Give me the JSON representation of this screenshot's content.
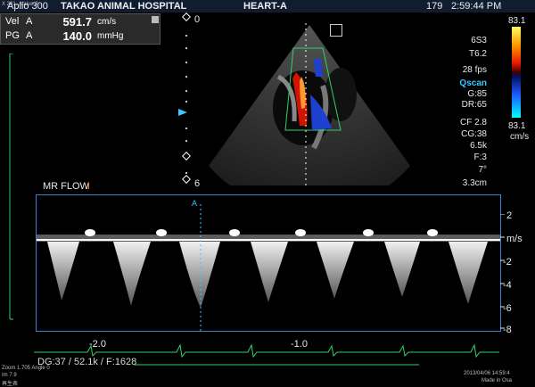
{
  "header": {
    "system": "Aplio 300",
    "hospital": "TAKAO ANIMAL HOSPITAL",
    "exam": "HEART-A",
    "frame": "179",
    "time": "2:59:44 PM",
    "corner_label": "X 201...Value 2 ..."
  },
  "measurements": [
    {
      "label": "Vel",
      "channel": "A",
      "value": "591.7",
      "unit": "cm/s"
    },
    {
      "label": "PG",
      "channel": "A",
      "value": "140.0",
      "unit": "mmHg"
    }
  ],
  "depth_scale": {
    "top": "0",
    "bottom": "6"
  },
  "params": {
    "probe": "6S3",
    "depth_mode": "T6.2",
    "fps": "28 fps",
    "qscan": "Qscan",
    "gain": "G:85",
    "dr": "DR:65",
    "cf": "CF 2.8",
    "cg": "CG:38",
    "prf": "6.5k",
    "filter": "F:3",
    "angle": "7°",
    "sample_depth": "3.3cm"
  },
  "colorbar": {
    "max": "83.1",
    "min": "83.1",
    "unit": "cm/s"
  },
  "doppler": {
    "title": "MR FLOW",
    "cursor_label": "A",
    "unit": "m/s",
    "ticks": [
      "2",
      "-2",
      "-4",
      "-6",
      "-8"
    ],
    "time_ticks": [
      "-2.0",
      "-1.0"
    ],
    "status": "DG:37 / 52.1k / F:1628"
  },
  "footer": {
    "zoom": "Zoom 1.705  Angle 0",
    "depth": "Im 7.9",
    "mode": "再生表",
    "datetime": "2013/04/06 14:59:4",
    "made_in": "Made in Osa"
  },
  "colors": {
    "accent_blue": "#3b7fd0",
    "ecg_green": "#2fd16a"
  }
}
